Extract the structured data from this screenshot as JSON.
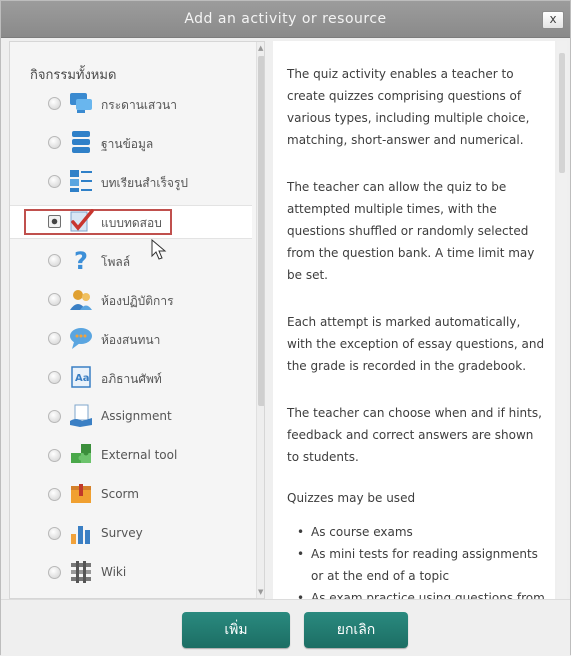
{
  "dialog": {
    "title": "Add an activity or resource",
    "close_label": "x"
  },
  "sidebar": {
    "heading": "กิจกรรมทั้งหมด",
    "items": [
      {
        "label": "กระดานเสวนา",
        "icon": "forum-icon"
      },
      {
        "label": "ฐานข้อมูล",
        "icon": "database-icon"
      },
      {
        "label": "บทเรียนสำเร็จรูป",
        "icon": "lesson-icon"
      },
      {
        "label": "แบบทดสอบ",
        "icon": "quiz-icon",
        "selected": true
      },
      {
        "label": "โพลล์",
        "icon": "choice-icon"
      },
      {
        "label": "ห้องปฏิบัติการ",
        "icon": "workshop-icon"
      },
      {
        "label": "ห้องสนทนา",
        "icon": "chat-icon"
      },
      {
        "label": "อภิธานศัพท์",
        "icon": "glossary-icon"
      },
      {
        "label": "Assignment",
        "icon": "assignment-icon"
      },
      {
        "label": "External tool",
        "icon": "external-tool-icon"
      },
      {
        "label": "Scorm",
        "icon": "scorm-icon"
      },
      {
        "label": "Survey",
        "icon": "survey-icon"
      },
      {
        "label": "Wiki",
        "icon": "wiki-icon"
      }
    ]
  },
  "description": {
    "paragraphs": [
      "The quiz activity enables a teacher to create quizzes comprising questions of various types, including multiple choice, matching, short-answer and numerical.",
      "The teacher can allow the quiz to be attempted multiple times, with the questions shuffled or randomly selected from the question bank. A time limit may be set.",
      "Each attempt is marked automatically, with the exception of essay questions, and the grade is recorded in the gradebook.",
      "The teacher can choose when and if hints, feedback and correct answers are shown to students.",
      "Quizzes may be used"
    ],
    "bullets": [
      "As course exams",
      "As mini tests for reading assignments or at the end of a topic",
      "As exam practice using questions from"
    ]
  },
  "footer": {
    "add_label": "เพิ่ม",
    "cancel_label": "ยกเลิก"
  },
  "colors": {
    "button": "#1f7a70",
    "highlight": "#c0504d"
  }
}
